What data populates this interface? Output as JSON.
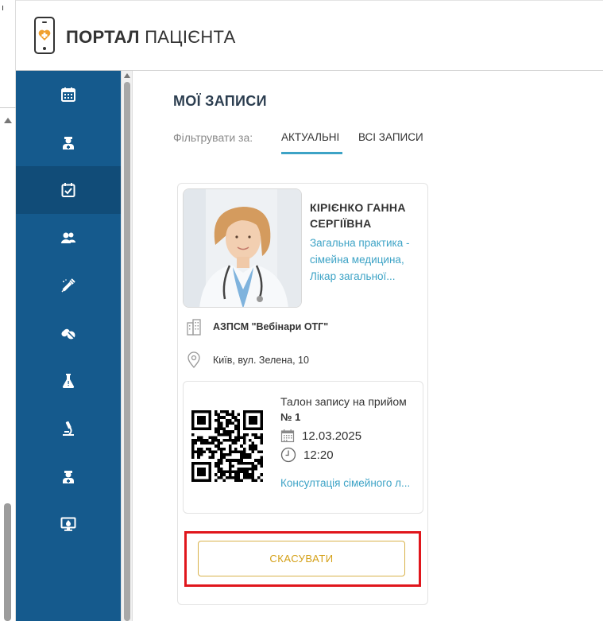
{
  "app": {
    "title_bold": "ПОРТАЛ",
    "title_light": "ПАЦІЄНТА"
  },
  "left_strip": {
    "mark": "ı"
  },
  "sidebar": {
    "items": [
      {
        "icon": "calendar-icon",
        "active": false
      },
      {
        "icon": "doctor-icon",
        "active": false
      },
      {
        "icon": "calendar-check-icon",
        "active": true
      },
      {
        "icon": "patients-icon",
        "active": false
      },
      {
        "icon": "vaccine-syringe-icon",
        "active": false
      },
      {
        "icon": "pills-icon",
        "active": false
      },
      {
        "icon": "lab-flask-icon",
        "active": false
      },
      {
        "icon": "microscope-icon",
        "active": false
      },
      {
        "icon": "doctor-icon",
        "active": false
      },
      {
        "icon": "telemedicine-icon",
        "active": false
      }
    ]
  },
  "main": {
    "page_title": "МОЇ ЗАПИСИ",
    "filter_label": "Фільтрувати за:",
    "tabs": [
      {
        "label": "АКТУАЛЬНІ",
        "active": true
      },
      {
        "label": "ВСІ ЗАПИСИ",
        "active": false
      }
    ]
  },
  "appointment": {
    "doctor_name": "КІРІЄНКО ГАННА СЕРГІЇВНА",
    "doctor_specialty": "Загальна практика - сімейна медицина, Лікар загальної...",
    "clinic": "АЗПСМ \"Вебінари ОТГ\"",
    "address": "Київ, вул. Зелена, 10",
    "ticket": {
      "title": "Талон запису на прийом",
      "number": "№ 1",
      "date": "12.03.2025",
      "time": "12:20",
      "service": "Консултація сімейного л..."
    },
    "cancel_label": "СКАСУВАТИ"
  },
  "colors": {
    "sidebar": "#155a8d",
    "sidebar_active": "#114c78",
    "accent": "#3da3c6",
    "cancel": "#d4a017",
    "highlight": "#e0161c"
  }
}
